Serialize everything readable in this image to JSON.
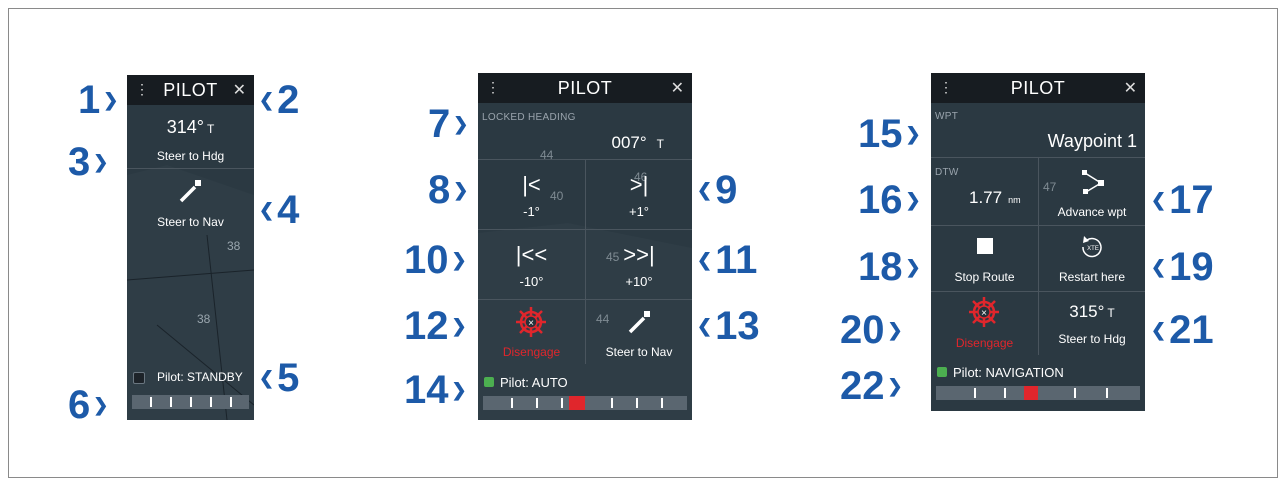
{
  "callouts": [
    "1",
    "2",
    "3",
    "4",
    "5",
    "6",
    "7",
    "8",
    "9",
    "10",
    "11",
    "12",
    "13",
    "14",
    "15",
    "16",
    "17",
    "18",
    "19",
    "20",
    "21",
    "22"
  ],
  "panel1": {
    "title": "PILOT",
    "heading_value": "314°",
    "heading_unit": "T",
    "steer_hdg_label": "Steer to Hdg",
    "steer_nav_label": "Steer to Nav",
    "status": "Pilot: STANDBY",
    "status_color": "#1d2329",
    "map_depths": [
      "38",
      "38"
    ]
  },
  "panel2": {
    "title": "PILOT",
    "locked_caption": "LOCKED HEADING",
    "locked_value": "007°",
    "locked_unit": "T",
    "minus1": "-1°",
    "plus1": "+1°",
    "minus10": "-10°",
    "plus10": "+10°",
    "disengage": "Disengage",
    "steer_nav_label": "Steer to Nav",
    "status": "Pilot: AUTO",
    "status_color": "#4caf50",
    "map_depths": [
      "44",
      "40",
      "46",
      "44",
      "45"
    ]
  },
  "panel3": {
    "title": "PILOT",
    "wpt_caption": "WPT",
    "waypoint": "Waypoint 1",
    "dtw_caption": "DTW",
    "dtw_value": "1.77",
    "dtw_unit": "nm",
    "advance_label": "Advance wpt",
    "stop_label": "Stop Route",
    "restart_label": "Restart here",
    "disengage": "Disengage",
    "heading_value": "315°",
    "heading_unit": "T",
    "steer_hdg_label": "Steer to Hdg",
    "status": "Pilot: NAVIGATION",
    "status_color": "#4caf50",
    "map_depths": [
      "47"
    ]
  },
  "colors": {
    "callout": "#1d5aa8",
    "accent_red": "#e0262c",
    "panel_bg": "#26313a",
    "header_bg": "#171c21"
  },
  "icons": [
    "menu-dots-icon",
    "close-icon",
    "steer-to-nav-icon",
    "step-back-icon",
    "step-forward-icon",
    "double-step-back-icon",
    "double-step-forward-icon",
    "helm-disengage-icon",
    "advance-waypoint-icon",
    "stop-icon",
    "restart-xte-icon"
  ]
}
